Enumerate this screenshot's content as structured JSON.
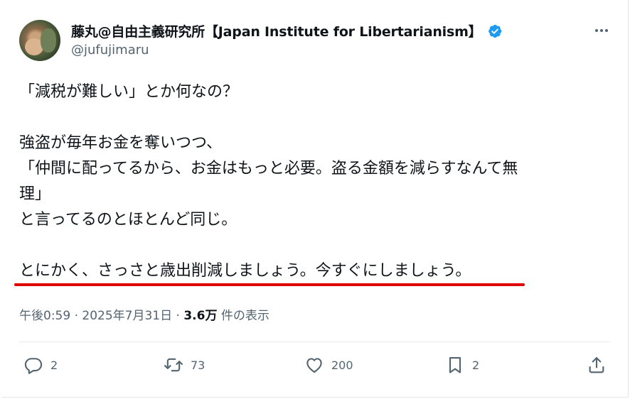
{
  "author": {
    "display_name": "藤丸@自由主義研究所【Japan Institute for Libertarianism】",
    "handle": "@jufujimaru",
    "verified": true
  },
  "tweet": {
    "lines": [
      "「減税が難しい」とか何なの？",
      "",
      "強盗が毎年お金を奪いつつ、",
      "「仲間に配ってるから、お金はもっと必要。盗る金額を減らすなんて無",
      "理」",
      "と言ってるのとほとんど同じ。",
      "",
      "とにかく、さっさと歳出削減しましょう。今すぐにしましょう。"
    ],
    "time": "午後0:59",
    "date": "2025年7月31日",
    "separator": "·",
    "views_count": "3.6万",
    "views_label": "件の表示"
  },
  "actions": {
    "replies": "2",
    "retweets": "73",
    "likes": "200",
    "bookmarks": "2"
  },
  "colors": {
    "verified": "#1d9bf0",
    "underline": "#e00000",
    "secondary_text": "#536471"
  },
  "icons": [
    "more-icon",
    "verified-icon",
    "reply-icon",
    "retweet-icon",
    "like-icon",
    "bookmark-icon",
    "share-icon"
  ]
}
